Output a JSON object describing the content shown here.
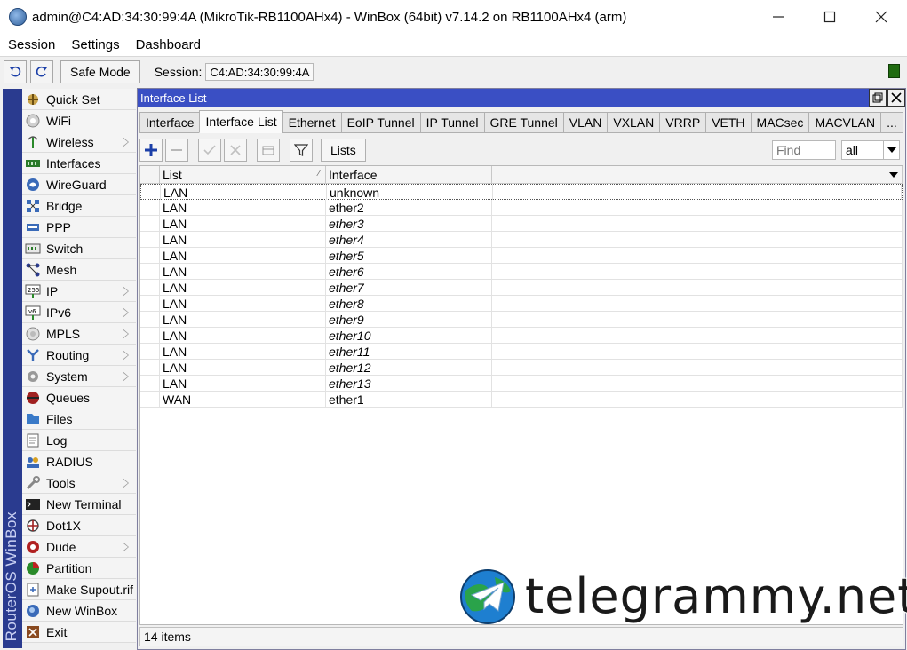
{
  "window": {
    "title": "admin@C4:AD:34:30:99:4A (MikroTik-RB1100AHx4) - WinBox (64bit) v7.14.2 on RB1100AHx4 (arm)",
    "minimize": "—",
    "maximize": "☐",
    "close": "✕"
  },
  "menu": {
    "session": "Session",
    "settings": "Settings",
    "dashboard": "Dashboard"
  },
  "toolbar": {
    "safe_mode": "Safe Mode",
    "session_label": "Session:",
    "session_value": "C4:AD:34:30:99:4A",
    "status_color": "#1f6b10"
  },
  "side_strip": {
    "text": "RouterOS WinBox"
  },
  "sidebar": {
    "items": [
      {
        "label": "Quick Set",
        "icon": "quick-set-icon",
        "submenu": false
      },
      {
        "label": "WiFi",
        "icon": "wifi-icon",
        "submenu": false
      },
      {
        "label": "Wireless",
        "icon": "wireless-icon",
        "submenu": true
      },
      {
        "label": "Interfaces",
        "icon": "interfaces-icon",
        "submenu": false
      },
      {
        "label": "WireGuard",
        "icon": "wireguard-icon",
        "submenu": false
      },
      {
        "label": "Bridge",
        "icon": "bridge-icon",
        "submenu": false
      },
      {
        "label": "PPP",
        "icon": "ppp-icon",
        "submenu": false
      },
      {
        "label": "Switch",
        "icon": "switch-icon",
        "submenu": false
      },
      {
        "label": "Mesh",
        "icon": "mesh-icon",
        "submenu": false
      },
      {
        "label": "IP",
        "icon": "ip-icon",
        "submenu": true
      },
      {
        "label": "IPv6",
        "icon": "ipv6-icon",
        "submenu": true
      },
      {
        "label": "MPLS",
        "icon": "mpls-icon",
        "submenu": true
      },
      {
        "label": "Routing",
        "icon": "routing-icon",
        "submenu": true
      },
      {
        "label": "System",
        "icon": "system-icon",
        "submenu": true
      },
      {
        "label": "Queues",
        "icon": "queues-icon",
        "submenu": false
      },
      {
        "label": "Files",
        "icon": "files-icon",
        "submenu": false
      },
      {
        "label": "Log",
        "icon": "log-icon",
        "submenu": false
      },
      {
        "label": "RADIUS",
        "icon": "radius-icon",
        "submenu": false
      },
      {
        "label": "Tools",
        "icon": "tools-icon",
        "submenu": true
      },
      {
        "label": "New Terminal",
        "icon": "terminal-icon",
        "submenu": false
      },
      {
        "label": "Dot1X",
        "icon": "dot1x-icon",
        "submenu": false
      },
      {
        "label": "Dude",
        "icon": "dude-icon",
        "submenu": true
      },
      {
        "label": "Partition",
        "icon": "partition-icon",
        "submenu": false
      },
      {
        "label": "Make Supout.rif",
        "icon": "supout-icon",
        "submenu": false
      },
      {
        "label": "New WinBox",
        "icon": "new-winbox-icon",
        "submenu": false
      },
      {
        "label": "Exit",
        "icon": "exit-icon",
        "submenu": false
      }
    ]
  },
  "interface_list_window": {
    "title": "Interface List",
    "tabs": [
      {
        "label": "Interface",
        "active": false
      },
      {
        "label": "Interface List",
        "active": true
      },
      {
        "label": "Ethernet",
        "active": false
      },
      {
        "label": "EoIP Tunnel",
        "active": false
      },
      {
        "label": "IP Tunnel",
        "active": false
      },
      {
        "label": "GRE Tunnel",
        "active": false
      },
      {
        "label": "VLAN",
        "active": false
      },
      {
        "label": "VXLAN",
        "active": false
      },
      {
        "label": "VRRP",
        "active": false
      },
      {
        "label": "VETH",
        "active": false
      },
      {
        "label": "MACsec",
        "active": false
      },
      {
        "label": "MACVLAN",
        "active": false
      },
      {
        "label": "...",
        "active": false
      }
    ],
    "lists_button": "Lists",
    "find_placeholder": "Find",
    "filter_value": "all",
    "columns": [
      "List",
      "Interface"
    ],
    "rows": [
      {
        "list": "LAN",
        "interface": "unknown",
        "italic": false
      },
      {
        "list": "LAN",
        "interface": "ether2",
        "italic": false
      },
      {
        "list": "LAN",
        "interface": "ether3",
        "italic": true
      },
      {
        "list": "LAN",
        "interface": "ether4",
        "italic": true
      },
      {
        "list": "LAN",
        "interface": "ether5",
        "italic": true
      },
      {
        "list": "LAN",
        "interface": "ether6",
        "italic": true
      },
      {
        "list": "LAN",
        "interface": "ether7",
        "italic": true
      },
      {
        "list": "LAN",
        "interface": "ether8",
        "italic": true
      },
      {
        "list": "LAN",
        "interface": "ether9",
        "italic": true
      },
      {
        "list": "LAN",
        "interface": "ether10",
        "italic": true
      },
      {
        "list": "LAN",
        "interface": "ether11",
        "italic": true
      },
      {
        "list": "LAN",
        "interface": "ether12",
        "italic": true
      },
      {
        "list": "LAN",
        "interface": "ether13",
        "italic": true
      },
      {
        "list": "WAN",
        "interface": "ether1",
        "italic": false
      }
    ],
    "status": "14 items"
  },
  "watermark": {
    "text": "telegrammy.net"
  },
  "colors": {
    "title_blue": "#3a4fc4",
    "strip_blue": "#2a3b8f",
    "add_blue": "#1b3fa8"
  }
}
